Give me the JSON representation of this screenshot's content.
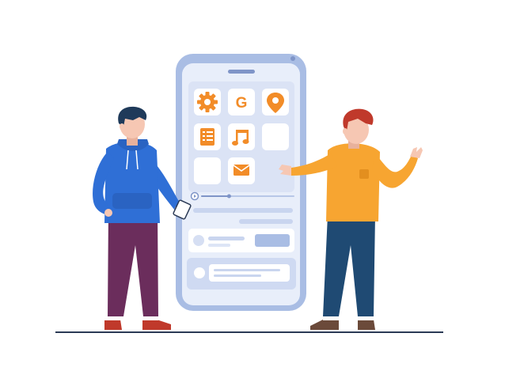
{
  "scene": {
    "description_kind": "flat illustration",
    "phone": {
      "app_grid": [
        {
          "name": "settings-app",
          "icon": "gear-icon"
        },
        {
          "name": "google-app",
          "icon": "g-letter-icon",
          "label": "G"
        },
        {
          "name": "maps-app",
          "icon": "location-pin-icon"
        },
        {
          "name": "notes-app",
          "icon": "list-icon"
        },
        {
          "name": "music-app",
          "icon": "music-note-icon"
        },
        {
          "name": "empty-app-slot",
          "icon": "blank"
        },
        {
          "name": "empty-app-slot",
          "icon": "blank"
        },
        {
          "name": "mail-app",
          "icon": "envelope-icon"
        }
      ],
      "media_progress": 0.3
    },
    "colors": {
      "phone_frame": "#a9bde4",
      "phone_screen": "#e8eefa",
      "accent_orange": "#f28c28",
      "tile_bg": "#ffffff",
      "person_left_hoodie": "#2f6fd6",
      "person_left_pants": "#6b2d5c",
      "person_right_sweater": "#f7a531",
      "person_right_pants": "#1f4a73",
      "skin": "#f6c7b3",
      "hair": "#1f3a5a",
      "hair_right": "#c0392b",
      "ground_line": "#2b3a55"
    }
  }
}
